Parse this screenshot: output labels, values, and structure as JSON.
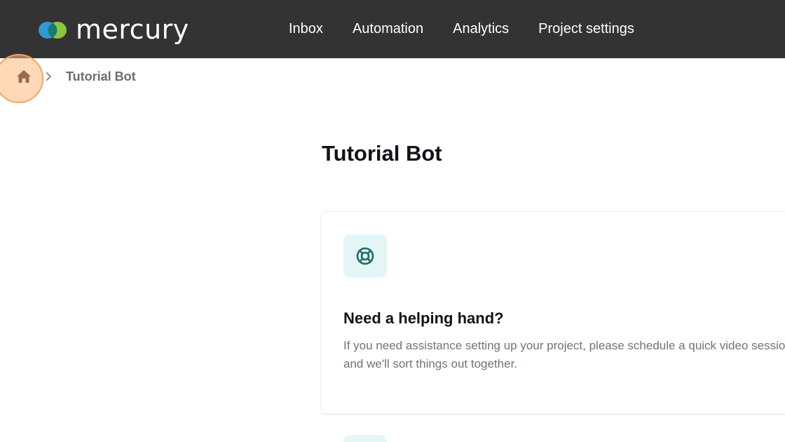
{
  "app": {
    "logo_text": "mercury"
  },
  "nav": {
    "items": [
      {
        "label": "Inbox"
      },
      {
        "label": "Automation"
      },
      {
        "label": "Analytics"
      },
      {
        "label": "Project settings"
      }
    ]
  },
  "breadcrumb": {
    "home_icon": "home-icon",
    "separator_icon": "chevron-right-icon",
    "current": "Tutorial Bot"
  },
  "page": {
    "title": "Tutorial Bot"
  },
  "help_card": {
    "icon": "lifebuoy-icon",
    "title": "Need a helping hand?",
    "description": "If you need assistance setting up your project, please schedule a quick video session, and we'll sort things out together."
  },
  "colors": {
    "topbar_bg": "#333333",
    "highlight": "#f5a45f",
    "icon_teal": "#1e6b6a",
    "icon_box_bg": "#e3f6f5"
  }
}
